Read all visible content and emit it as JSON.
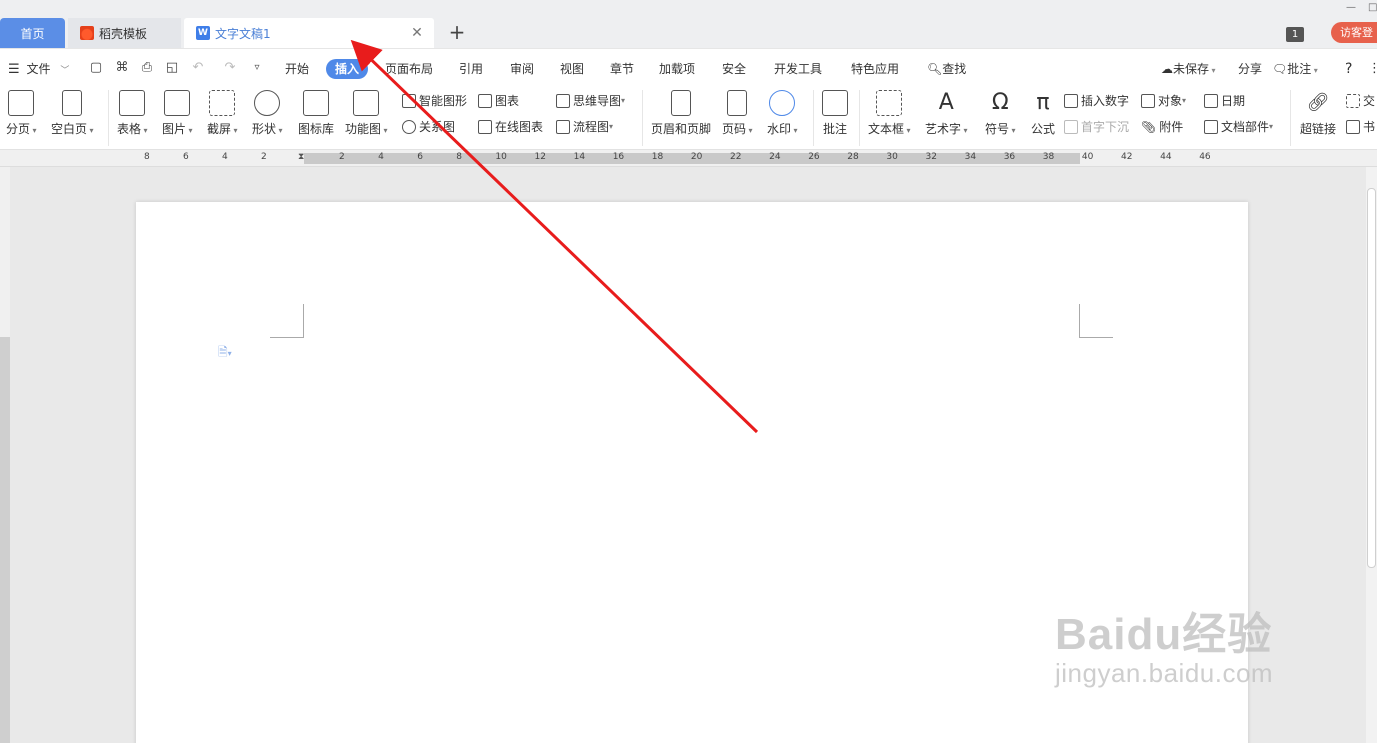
{
  "tabs": {
    "home": "首页",
    "template": "稻壳模板",
    "document": "文字文稿1",
    "badge": "1",
    "visitor": "访客登"
  },
  "menu": {
    "file": "文件",
    "items": [
      "开始",
      "插入",
      "页面布局",
      "引用",
      "审阅",
      "视图",
      "章节",
      "加载项",
      "安全",
      "开发工具",
      "特色应用"
    ],
    "active": "插入",
    "search": "查找",
    "unsaved": "未保存",
    "share": "分享",
    "comment": "批注",
    "help": "?"
  },
  "ribbon": {
    "page_break": "分页",
    "blank_page": "空白页",
    "table": "表格",
    "picture": "图片",
    "screenshot": "截屏",
    "shape": "形状",
    "icon_lib": "图标库",
    "func_chart": "功能图",
    "smart_shape": "智能图形",
    "chart": "图表",
    "mind_map": "思维导图",
    "relation": "关系图",
    "online_chart": "在线图表",
    "flowchart": "流程图",
    "header_footer": "页眉和页脚",
    "page_number": "页码",
    "watermark": "水印",
    "annotation": "批注",
    "textbox": "文本框",
    "art_text": "艺术字",
    "symbol": "符号",
    "formula": "公式",
    "insert_number": "插入数字",
    "object": "对象",
    "date": "日期",
    "drop_cap": "首字下沉",
    "attachment": "附件",
    "doc_parts": "文档部件",
    "hyperlink": "超链接",
    "cross_ref": "交",
    "bookmark": "书"
  },
  "ruler": {
    "left_numbers": [
      "8",
      "6",
      "4",
      "2"
    ],
    "right_numbers": [
      "2",
      "4",
      "6",
      "8",
      "10",
      "12",
      "14",
      "16",
      "18",
      "20",
      "22",
      "24",
      "26",
      "28",
      "30",
      "32",
      "34",
      "36",
      "38",
      "40",
      "42",
      "44",
      "46"
    ]
  },
  "watermark_site": {
    "main": "Baidu经验",
    "sub": "jingyan.baidu.com"
  },
  "colors": {
    "accent": "#4f89e8",
    "arrow": "#e81c1c",
    "visitor": "#e7614c"
  }
}
